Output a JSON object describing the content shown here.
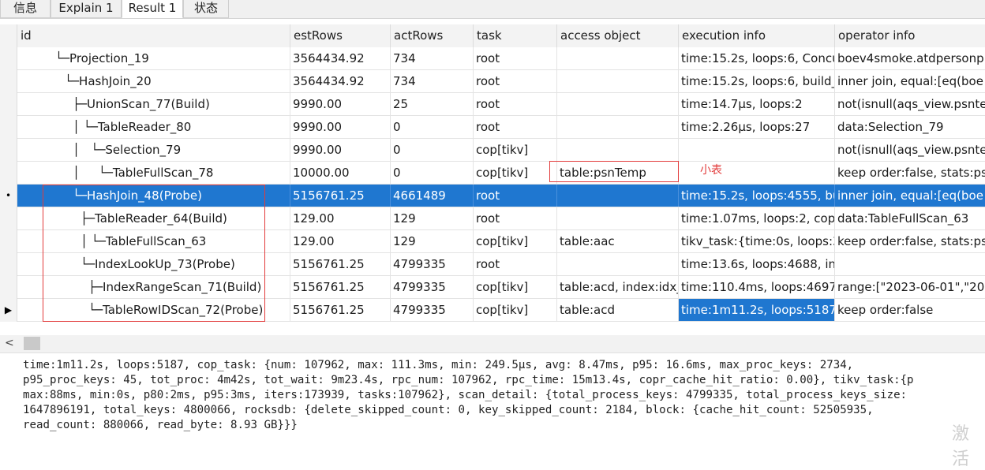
{
  "tabs": [
    "信息",
    "Explain 1",
    "Result 1",
    "状态"
  ],
  "active_tab": "Result 1",
  "columns": [
    "id",
    "estRows",
    "actRows",
    "task",
    "access object",
    "execution info",
    "operator info"
  ],
  "rows": [
    {
      "id": "└─Projection_19",
      "estRows": "3564434.92",
      "actRows": "734",
      "task": "root",
      "access": "",
      "exec": "time:15.2s, loops:6, Concu",
      "op": "boev4smoke.atdpersonp"
    },
    {
      "id": "└─HashJoin_20",
      "estRows": "3564434.92",
      "actRows": "734",
      "task": "root",
      "access": "",
      "exec": "time:15.2s, loops:6, build_",
      "op": "inner join, equal:[eq(boe"
    },
    {
      "id": "├─UnionScan_77(Build)",
      "estRows": "9990.00",
      "actRows": "25",
      "task": "root",
      "access": "",
      "exec": "time:14.7µs, loops:2",
      "op": "not(isnull(aqs_view.psnte"
    },
    {
      "id": "│ └─TableReader_80",
      "estRows": "9990.00",
      "actRows": "0",
      "task": "root",
      "access": "",
      "exec": "time:2.26µs, loops:27",
      "op": "data:Selection_79"
    },
    {
      "id": "│   └─Selection_79",
      "estRows": "9990.00",
      "actRows": "0",
      "task": "cop[tikv]",
      "access": "",
      "exec": "",
      "op": "not(isnull(aqs_view.psnte"
    },
    {
      "id": "│     └─TableFullScan_78",
      "estRows": "10000.00",
      "actRows": "0",
      "task": "cop[tikv]",
      "access": "table:psnTemp",
      "exec": "",
      "op": "keep order:false, stats:ps"
    },
    {
      "id": "└─HashJoin_48(Probe)",
      "estRows": "5156761.25",
      "actRows": "4661489",
      "task": "root",
      "access": "",
      "exec": "time:15.2s, loops:4555, bu",
      "op": "inner join, equal:[eq(boe"
    },
    {
      "id": "├─TableReader_64(Build)",
      "estRows": "129.00",
      "actRows": "129",
      "task": "root",
      "access": "",
      "exec": "time:1.07ms, loops:2, cop",
      "op": "data:TableFullScan_63"
    },
    {
      "id": "│ └─TableFullScan_63",
      "estRows": "129.00",
      "actRows": "129",
      "task": "cop[tikv]",
      "access": "table:aac",
      "exec": "tikv_task:{time:0s, loops:3",
      "op": "keep order:false, stats:ps"
    },
    {
      "id": "└─IndexLookUp_73(Probe)",
      "estRows": "5156761.25",
      "actRows": "4799335",
      "task": "root",
      "access": "",
      "exec": "time:13.6s, loops:4688, in",
      "op": ""
    },
    {
      "id": "├─IndexRangeScan_71(Build)",
      "estRows": "5156761.25",
      "actRows": "4799335",
      "task": "cop[tikv]",
      "access": "table:acd, index:idx_",
      "exec": "time:110.4ms, loops:4697,",
      "op": "range:[\"2023-06-01\",\"202"
    },
    {
      "id": "└─TableRowIDScan_72(Probe)",
      "estRows": "5156761.25",
      "actRows": "4799335",
      "task": "cop[tikv]",
      "access": "table:acd",
      "exec": "time:1m11.2s, loops:5187",
      "op": "keep order:false"
    }
  ],
  "annotation_note": "小表",
  "detail_lines": [
    "time:1m11.2s, loops:5187, cop_task: {num: 107962, max: 111.3ms, min: 249.5µs, avg: 8.47ms, p95: 16.6ms, max_proc_keys: 2734,",
    "p95_proc_keys: 45, tot_proc: 4m42s, tot_wait: 9m23.4s, rpc_num: 107962, rpc_time: 15m13.4s, copr_cache_hit_ratio: 0.00}, tikv_task:{p",
    "max:88ms, min:0s, p80:2ms, p95:3ms, iters:173939, tasks:107962}, scan_detail: {total_process_keys: 4799335, total_process_keys_size:",
    "1647896191, total_keys: 4800066, rocksdb: {delete_skipped_count: 0, key_skipped_count: 2184, block: {cache_hit_count: 52505935,",
    "read_count: 880066, read_byte: 8.93 GB}}}"
  ],
  "watermark": "激活"
}
